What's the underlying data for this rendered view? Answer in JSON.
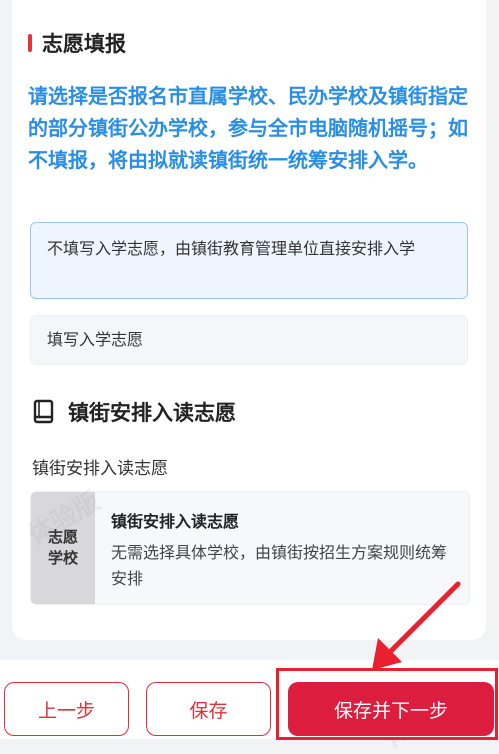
{
  "section": {
    "title": "志愿填报"
  },
  "notice": "请选择是否报名市直属学校、民办学校及镇街指定的部分镇街公办学校，参与全市电脑随机摇号；如不填报，将由拟就读镇街统一统筹安排入学。",
  "options": [
    {
      "label": "不填写入学志愿，由镇街教育管理单位直接安排入学",
      "selected": true
    },
    {
      "label": "填写入学志愿",
      "selected": false
    }
  ],
  "assignment": {
    "title": "镇街安排入读志愿",
    "field_label": "镇街安排入读志愿",
    "card": {
      "tag_line1": "志愿",
      "tag_line2": "学校",
      "name": "镇街安排入读志愿",
      "description": "无需选择具体学校，由镇街按招生方案规则统筹安排"
    }
  },
  "watermark": "体验版",
  "buttons": {
    "prev": "上一步",
    "save": "保存",
    "save_next": "保存并下一步"
  },
  "colors": {
    "accent_red": "#dd1d3d",
    "notice_blue": "#2a8fe4",
    "selected_bg": "#eef5ff"
  }
}
